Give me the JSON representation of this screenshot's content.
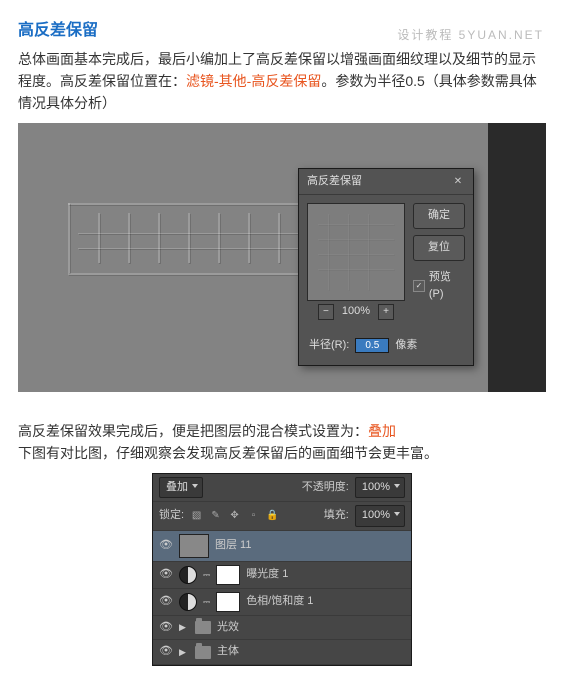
{
  "watermark": "设计教程 5YUAN.NET",
  "section1": {
    "heading": "高反差保留",
    "text_before": "总体画面基本完成后，最后小编加上了高反差保留以增强画面细纹理以及细节的显示程度。高反差保留位置在：",
    "highlight": "滤镜-其他-高反差保留",
    "text_after": "。参数为半径0.5（具体参数需具体情况具体分析）"
  },
  "dialog": {
    "title": "高反差保留",
    "ok": "确定",
    "cancel": "复位",
    "preview_label": "预览(P)",
    "zoom": "100%",
    "radius_label": "半径(R):",
    "radius_value": "0.5",
    "radius_unit": "像素"
  },
  "section2": {
    "text_before": "高反差保留效果完成后，便是把图层的混合模式设置为：",
    "highlight": "叠加",
    "text_after": "下图有对比图，仔细观察会发现高反差保留后的画面细节会更丰富。"
  },
  "layers": {
    "blend": "叠加",
    "opacity_label": "不透明度:",
    "opacity_value": "100%",
    "lock_label": "锁定:",
    "fill_label": "填充:",
    "fill_value": "100%",
    "layer1": "图层 11",
    "adj1": "曝光度 1",
    "adj2": "色相/饱和度 1",
    "grp1": "光效",
    "grp2": "主体"
  }
}
